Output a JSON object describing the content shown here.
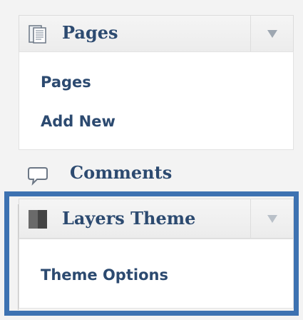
{
  "menu": {
    "pages": {
      "header_label": "Pages",
      "icon": "pages-icon",
      "submenu": [
        "Pages",
        "Add New"
      ]
    },
    "comments": {
      "header_label": "Comments",
      "icon": "comments-icon"
    },
    "layers": {
      "header_label": "Layers Theme",
      "icon": "layers-theme-icon",
      "submenu": [
        "Theme Options"
      ]
    }
  },
  "colors": {
    "link": "#2c4a70",
    "highlight": "#3d72b1"
  }
}
